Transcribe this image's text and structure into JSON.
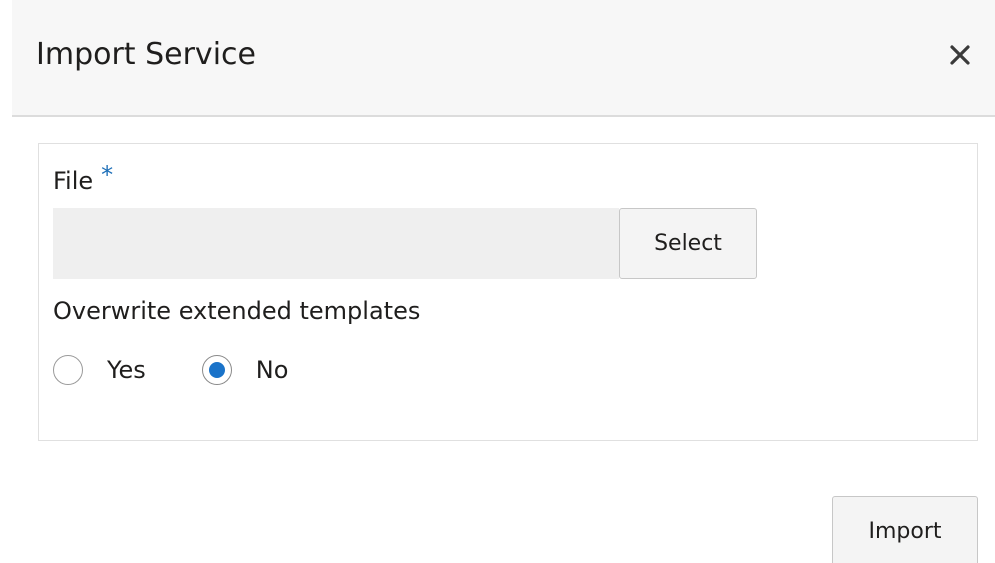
{
  "dialog": {
    "title": "Import Service",
    "close_icon": "close-icon"
  },
  "form": {
    "file_label": "File",
    "required_mark": "*",
    "file_value": "",
    "select_label": "Select",
    "overwrite_label": "Overwrite extended templates",
    "overwrite_options": [
      {
        "label": "Yes",
        "checked": false
      },
      {
        "label": "No",
        "checked": true
      }
    ]
  },
  "footer": {
    "import_label": "Import"
  },
  "colors": {
    "accent": "#1a73c9",
    "required": "#1d6fb8",
    "header_bg": "#f7f7f7"
  }
}
